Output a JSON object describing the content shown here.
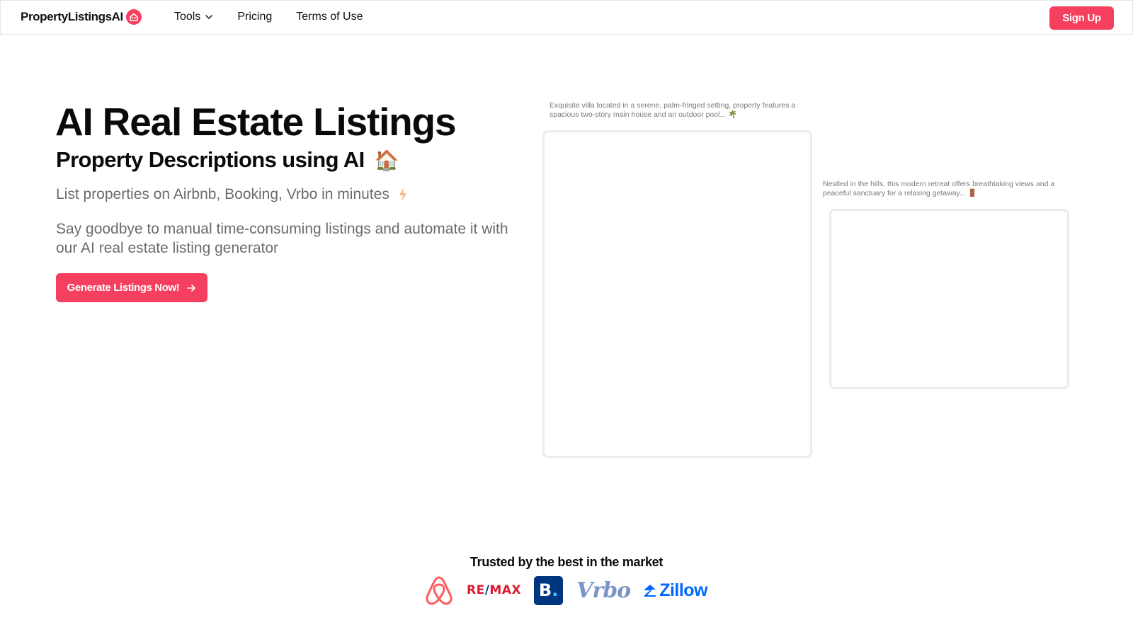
{
  "nav": {
    "brand": "PropertyListingsAI",
    "brand_icon": "house-icon",
    "links": [
      {
        "label": "Tools",
        "icon": "chevron-down-icon"
      },
      {
        "label": "Pricing"
      },
      {
        "label": "Terms of Use"
      }
    ],
    "signup_label": "Sign Up"
  },
  "hero": {
    "title": "AI Real Estate Listings",
    "subtitle": "Property Descriptions using AI",
    "subtitle_emoji": "🏠",
    "tagline": "List properties on Airbnb, Booking, Vrbo in minutes",
    "tagline_icon": "lightning-icon",
    "description": "Say goodbye to manual time-consuming listings and automate it with our AI real estate listing generator",
    "cta_label": "Generate Listings Now!",
    "cta_icon": "arrow-right-icon"
  },
  "cards": [
    {
      "caption": "Exquisite villa located in a serene, palm-fringed setting, property features a spacious two-story main house and an outdoor pool... 🌴"
    },
    {
      "caption": "Nestled in the hills, this modern retreat offers breathtaking views and a peaceful sanctuary for a relaxing getaway... 🚪"
    }
  ],
  "trusted": {
    "heading": "Trusted by the best in the market",
    "logos": [
      "Airbnb",
      "RE/MAX",
      "B.",
      "Vrbo",
      "Zillow"
    ]
  },
  "colors": {
    "accent": "#f43f5e",
    "text_muted": "#6b6b6b",
    "remax_red": "#dc1c2e",
    "booking_blue": "#003580",
    "vrbo_blue": "#3d5a9e",
    "zillow_blue": "#006aff"
  }
}
